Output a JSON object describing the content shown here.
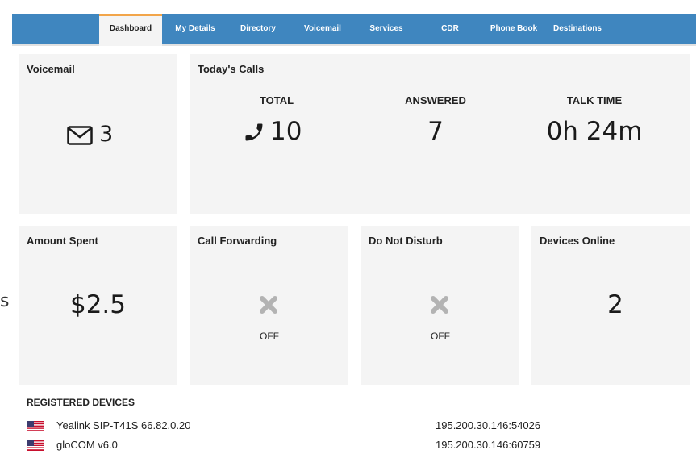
{
  "nav": {
    "tabs": [
      {
        "label": "Dashboard",
        "active": true
      },
      {
        "label": "My Details"
      },
      {
        "label": "Directory"
      },
      {
        "label": "Voicemail"
      },
      {
        "label": "Services"
      },
      {
        "label": "CDR"
      },
      {
        "label": "Phone Book"
      },
      {
        "label": "Destinations"
      }
    ]
  },
  "voicemail": {
    "title": "Voicemail",
    "count": "3",
    "icon": "envelope-icon"
  },
  "todays_calls": {
    "title": "Today's Calls",
    "total_label": "TOTAL",
    "total_value": "10",
    "icon": "phone-icon",
    "answered_label": "ANSWERED",
    "answered_value": "7",
    "talk_time_label": "TALK TIME",
    "talk_time_value": "0h 24m"
  },
  "amount_spent": {
    "title": "Amount Spent",
    "value": "$2.5"
  },
  "call_forwarding": {
    "title": "Call Forwarding",
    "status": "OFF",
    "icon": "x-icon"
  },
  "do_not_disturb": {
    "title": "Do Not Disturb",
    "status": "OFF",
    "icon": "x-icon"
  },
  "devices_online": {
    "title": "Devices Online",
    "value": "2"
  },
  "side_text": "s",
  "registered_devices": {
    "title": "REGISTERED DEVICES",
    "rows": [
      {
        "name": "Yealink SIP-T41S 66.82.0.20",
        "ip": "195.200.30.146:54026",
        "flag": "us-flag-icon"
      },
      {
        "name": "gloCOM v6.0",
        "ip": "195.200.30.146:60759",
        "flag": "us-flag-icon"
      }
    ]
  },
  "colors": {
    "nav": "#3f86bf",
    "card": "#f4f4f4",
    "active_tab_accent": "#f2a54a"
  }
}
